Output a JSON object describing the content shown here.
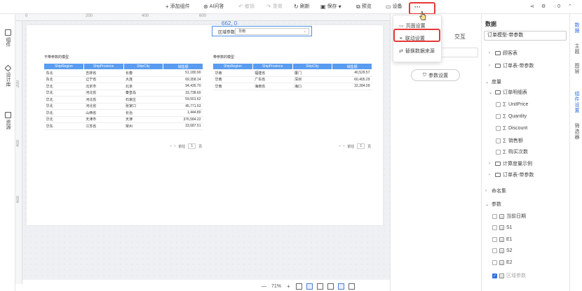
{
  "toolbar": {
    "add_component": "添加组件",
    "ai_qa": "AI问答",
    "undo": "撤销",
    "redo": "重做",
    "refresh": "刷新",
    "save": "保存",
    "preview": "预览",
    "device": "设备",
    "more": "···",
    "comments": "0"
  },
  "left_sidebar": {
    "components": "组件",
    "design_lib": "设计库",
    "resources": "资源"
  },
  "ruler": {
    "top": [
      "0",
      "200",
      "400",
      "600"
    ],
    "left": [
      "200",
      "400",
      "600"
    ]
  },
  "canvas": {
    "coord": "662, 0",
    "param_label": "区域参数",
    "param_value": "华南"
  },
  "table_left": {
    "title": "不带参数的模型",
    "headers": [
      "ShipRegion",
      "ShipProvince",
      "ShipCity",
      "销售额"
    ],
    "rows": [
      [
        "东北",
        "吉林省",
        "长春",
        "51,180.90"
      ],
      [
        "东北",
        "辽宁省",
        "大连",
        "69,358.14"
      ],
      [
        "华北",
        "北京市",
        "北京",
        "94,435.70"
      ],
      [
        "华北",
        "河北省",
        "秦皇岛",
        "33,738.60"
      ],
      [
        "华北",
        "河北省",
        "石家庄",
        "59,501.62"
      ],
      [
        "华北",
        "河北省",
        "张家口",
        "45,771.53"
      ],
      [
        "华北",
        "山西省",
        "长治",
        "1,444.80"
      ],
      [
        "华北",
        "天津市",
        "天津",
        "376,584.22"
      ],
      [
        "华东",
        "江苏省",
        "常州",
        "33,687.51"
      ]
    ],
    "pager_prev": "‹",
    "pager_next": "›",
    "pager_goto": "前往",
    "pager_page": "1",
    "pager_unit": "页"
  },
  "table_right": {
    "title": "带参数的模型",
    "headers": [
      "ShipRegion",
      "ShipProvince",
      "ShipCity",
      "销售额"
    ],
    "rows": [
      [
        "华南",
        "福建省",
        "厦门",
        "40,529.57"
      ],
      [
        "华南",
        "广东省",
        "深圳",
        "60,405.29"
      ],
      [
        "华南",
        "海南省",
        "海口",
        "32,284.09"
      ]
    ],
    "pager_prev": "‹",
    "pager_next": "›",
    "pager_goto": "前往",
    "pager_page": "1",
    "pager_unit": "页"
  },
  "zoom": {
    "minus": "—",
    "level": "71%",
    "plus": "+"
  },
  "dropdown": {
    "items": [
      "页面设置",
      "联动设置",
      "替换数据来源"
    ]
  },
  "mid_panel": {
    "tab_interact": "交互",
    "param_settings": "参数设置"
  },
  "data_panel": {
    "title": "数据",
    "model": "订单模型-带参数",
    "tree": {
      "customers": "顾客表",
      "orders_param": "订单表-带参数",
      "measures": "度量",
      "order_details": "订单明细表",
      "fields": [
        "UnitPrice",
        "Quantity",
        "Discount",
        "销售额",
        "购买次数"
      ],
      "calc_examples": "计算度量示例",
      "orders_param2": "订单表-带参数",
      "named_sets": "命名集",
      "params": "参数",
      "param_items": [
        "当前日期",
        "S1",
        "E1",
        "S2",
        "E2",
        "区域参数"
      ]
    }
  },
  "vtabs": [
    "数据",
    "主题",
    "图层",
    "组件设置",
    "筛选器"
  ],
  "colors": {
    "accent": "#2f6fdc",
    "table_header": "#5a9cf0",
    "highlight": "#e53935"
  }
}
